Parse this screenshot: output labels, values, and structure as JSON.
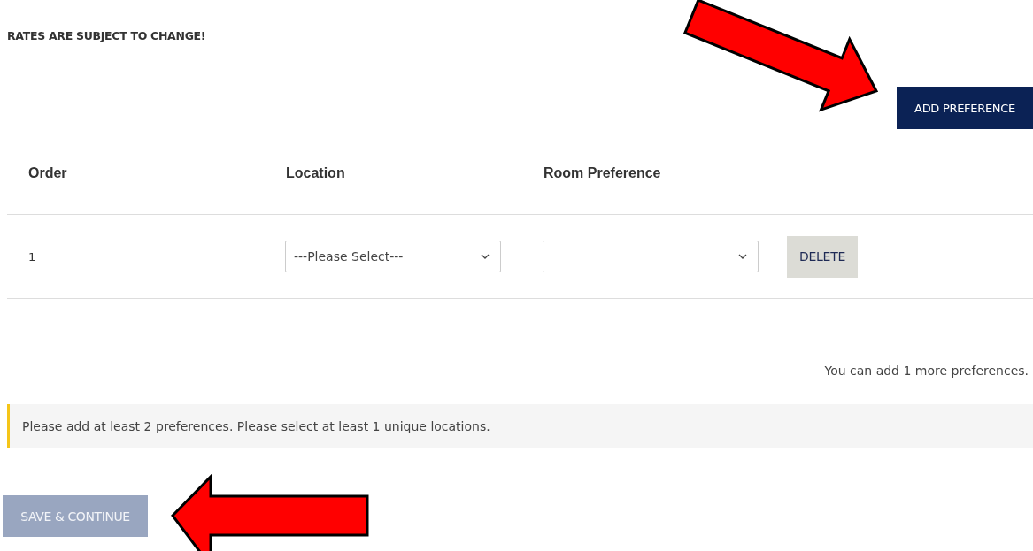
{
  "notice": "RATES ARE SUBJECT TO CHANGE!",
  "add_button": {
    "label": "ADD PREFERENCE"
  },
  "table": {
    "columns": [
      "Order",
      "Location",
      "Room Preference"
    ],
    "rows": [
      {
        "order": "1",
        "location": {
          "value": "---Please Select---"
        },
        "delete_label": "DELETE"
      }
    ]
  },
  "remaining_note": "You can add 1 more preferences.",
  "alert": {
    "message": "Please add at least 2 preferences. Please select at least 1 unique locations."
  },
  "save_button": {
    "label": "SAVE & CONTINUE",
    "disabled": true
  }
}
